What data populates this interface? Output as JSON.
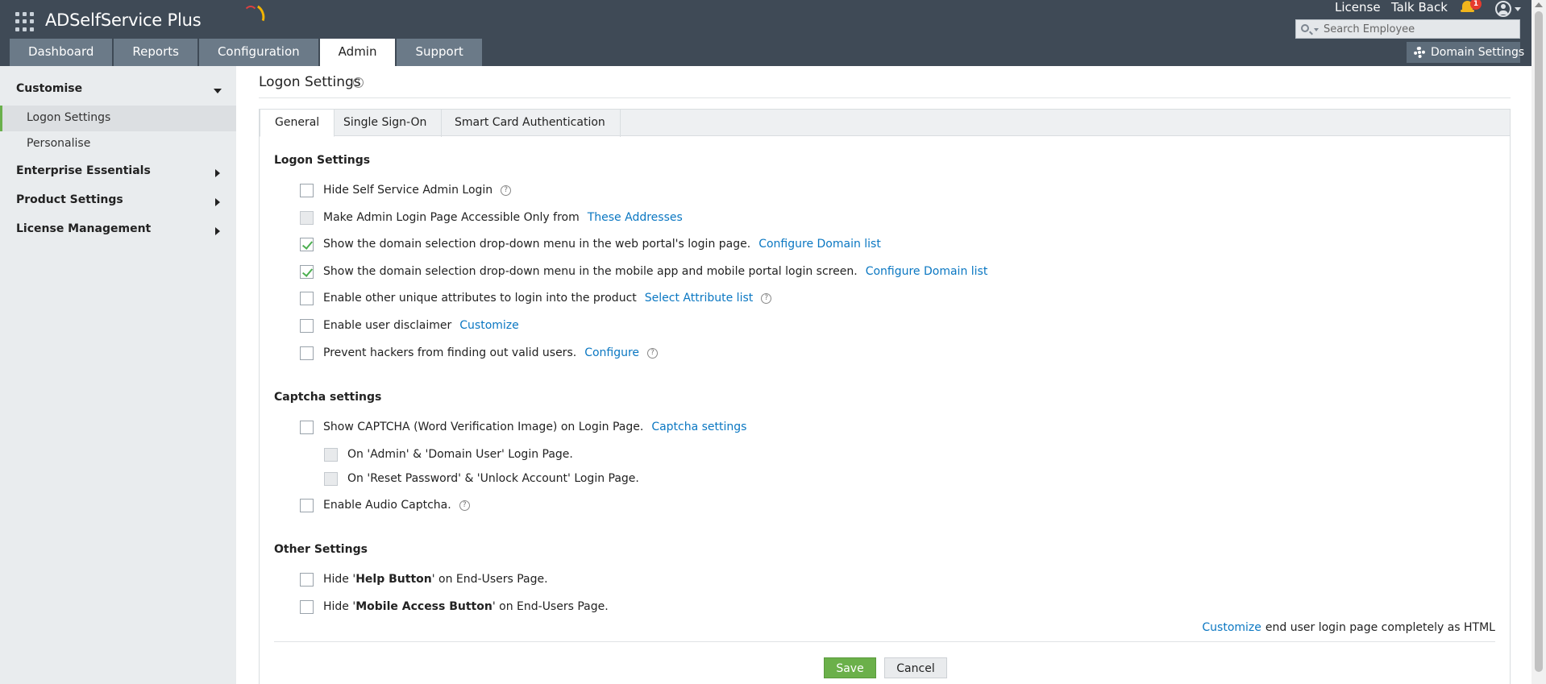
{
  "header": {
    "app_name": "ADSelfService Plus",
    "links": {
      "license": "License",
      "talk_back": "Talk Back"
    },
    "notification_count": "1",
    "search_placeholder": "Search Employee",
    "tabs": [
      "Dashboard",
      "Reports",
      "Configuration",
      "Admin",
      "Support"
    ],
    "active_tab": "Admin",
    "domain_settings": "Domain Settings"
  },
  "sidebar": {
    "sections": [
      {
        "label": "Customise",
        "expanded": true,
        "items": [
          "Logon Settings",
          "Personalise"
        ]
      },
      {
        "label": "Enterprise Essentials",
        "expanded": false
      },
      {
        "label": "Product Settings",
        "expanded": false
      },
      {
        "label": "License Management",
        "expanded": false
      }
    ],
    "active_item": "Logon Settings"
  },
  "main": {
    "title": "Logon Settings",
    "help_glyph": "?",
    "tabs": [
      "General",
      "Single Sign-On",
      "Smart Card Authentication"
    ],
    "active_tab": "General",
    "logon": {
      "title": "Logon Settings",
      "rows": [
        {
          "label": "Hide Self Service Admin Login",
          "checked": false
        },
        {
          "label": "Make Admin Login Page Accessible Only from",
          "link": "These Addresses",
          "disabled": true
        },
        {
          "label": "Show the domain selection drop-down menu in the web portal's login page.",
          "link": "Configure Domain list",
          "checked": true
        },
        {
          "label": "Show the domain selection drop-down menu in the mobile app and mobile portal login screen.",
          "link": "Configure Domain list",
          "checked": true
        },
        {
          "label": "Enable other unique attributes to login into the product",
          "link": "Select Attribute list",
          "checked": false
        },
        {
          "label": "Enable user disclaimer",
          "link": "Customize",
          "checked": false
        },
        {
          "label": "Prevent hackers from finding out valid users.",
          "link": "Configure",
          "checked": false
        }
      ]
    },
    "captcha": {
      "title": "Captcha settings",
      "show_label": "Show CAPTCHA (Word Verification Image) on Login Page.",
      "show_link": "Captcha settings",
      "sub1": "On 'Admin' & 'Domain User' Login Page.",
      "sub2": "On 'Reset Password' & 'Unlock Account' Login Page.",
      "audio": "Enable Audio Captcha."
    },
    "other": {
      "title": "Other Settings",
      "help_prefix": "Hide '",
      "help_bold": "Help Button",
      "help_suffix": "' on End-Users Page.",
      "mobile_prefix": "Hide '",
      "mobile_bold": "Mobile Access Button",
      "mobile_suffix": "' on End-Users Page."
    },
    "customize_link": "Customize",
    "customize_text": "end user login page completely as HTML",
    "save": "Save",
    "cancel": "Cancel"
  }
}
